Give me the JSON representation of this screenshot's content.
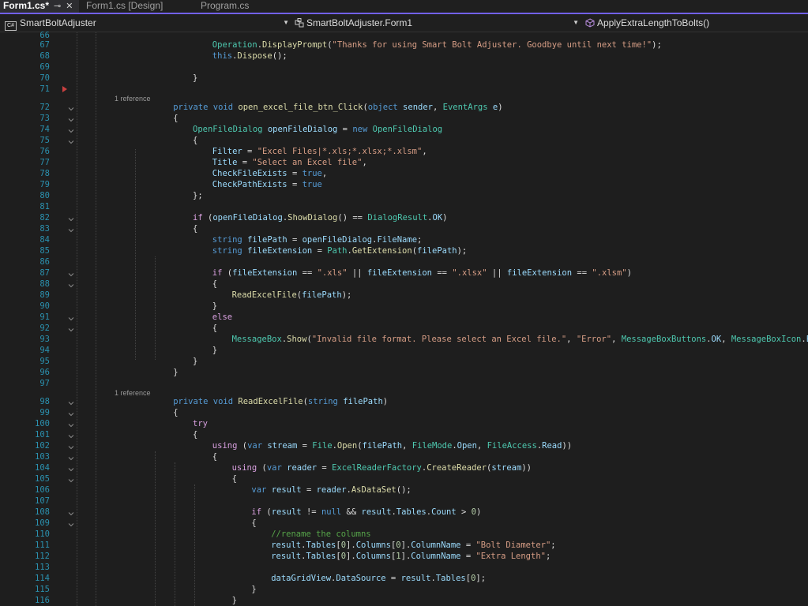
{
  "tabs": [
    {
      "label": "Form1.cs*",
      "active": true
    },
    {
      "label": "Form1.cs [Design]",
      "active": false
    },
    {
      "label": "Program.cs",
      "active": false
    }
  ],
  "tab_icons": {
    "pin": "⊸",
    "close": "✕"
  },
  "nav": {
    "project": "SmartBoltAdjuster",
    "cls": "SmartBoltAdjuster.Form1",
    "member": "ApplyExtraLengthToBolts()",
    "cs_icon_text": "C#"
  },
  "refs": {
    "r72": "1 reference",
    "r98": "1 reference"
  },
  "lines": [
    {
      "n": "66",
      "tokens": []
    },
    {
      "n": "67",
      "tokens": [
        [
          "t",
          "Operation"
        ],
        [
          "p",
          "."
        ],
        [
          "m",
          "DisplayPrompt"
        ],
        [
          "p",
          "("
        ],
        [
          "s",
          "\"Thanks for using Smart Bolt Adjuster. Goodbye until next time!\""
        ],
        [
          "p",
          ");"
        ]
      ]
    },
    {
      "n": "68",
      "tokens": [
        [
          "k",
          "this"
        ],
        [
          "p",
          "."
        ],
        [
          "m",
          "Dispose"
        ],
        [
          "p",
          "();"
        ]
      ]
    },
    {
      "n": "69",
      "tokens": []
    },
    {
      "n": "70",
      "tokens": [
        [
          "p",
          "}"
        ]
      ]
    },
    {
      "n": "71",
      "tokens": []
    },
    {
      "n": "72",
      "tokens": [
        [
          "k",
          "private"
        ],
        [
          "p",
          " "
        ],
        [
          "k",
          "void"
        ],
        [
          "p",
          " "
        ],
        [
          "m",
          "open_excel_file_btn_Click"
        ],
        [
          "p",
          "("
        ],
        [
          "k",
          "object"
        ],
        [
          "p",
          " "
        ],
        [
          "v",
          "sender"
        ],
        [
          "p",
          ", "
        ],
        [
          "t",
          "EventArgs"
        ],
        [
          "p",
          " "
        ],
        [
          "v",
          "e"
        ],
        [
          "p",
          ")"
        ]
      ]
    },
    {
      "n": "73",
      "tokens": [
        [
          "p",
          "{"
        ]
      ]
    },
    {
      "n": "74",
      "tokens": [
        [
          "t",
          "OpenFileDialog"
        ],
        [
          "p",
          " "
        ],
        [
          "v",
          "openFileDialog"
        ],
        [
          "p",
          " = "
        ],
        [
          "k",
          "new"
        ],
        [
          "p",
          " "
        ],
        [
          "t",
          "OpenFileDialog"
        ]
      ]
    },
    {
      "n": "75",
      "tokens": [
        [
          "p",
          "{"
        ]
      ]
    },
    {
      "n": "76",
      "tokens": [
        [
          "v",
          "Filter"
        ],
        [
          "p",
          " = "
        ],
        [
          "s",
          "\"Excel Files|*.xls;*.xlsx;*.xlsm\""
        ],
        [
          "p",
          ","
        ]
      ]
    },
    {
      "n": "77",
      "tokens": [
        [
          "v",
          "Title"
        ],
        [
          "p",
          " = "
        ],
        [
          "s",
          "\"Select an Excel file\""
        ],
        [
          "p",
          ","
        ]
      ]
    },
    {
      "n": "78",
      "tokens": [
        [
          "v",
          "CheckFileExists"
        ],
        [
          "p",
          " = "
        ],
        [
          "k",
          "true"
        ],
        [
          "p",
          ","
        ]
      ]
    },
    {
      "n": "79",
      "tokens": [
        [
          "v",
          "CheckPathExists"
        ],
        [
          "p",
          " = "
        ],
        [
          "k",
          "true"
        ]
      ]
    },
    {
      "n": "80",
      "tokens": [
        [
          "p",
          "};"
        ]
      ]
    },
    {
      "n": "81",
      "tokens": []
    },
    {
      "n": "82",
      "tokens": [
        [
          "cf",
          "if"
        ],
        [
          "p",
          " ("
        ],
        [
          "v",
          "openFileDialog"
        ],
        [
          "p",
          "."
        ],
        [
          "m",
          "ShowDialog"
        ],
        [
          "p",
          "() == "
        ],
        [
          "t",
          "DialogResult"
        ],
        [
          "p",
          "."
        ],
        [
          "v",
          "OK"
        ],
        [
          "p",
          ")"
        ]
      ]
    },
    {
      "n": "83",
      "tokens": [
        [
          "p",
          "{"
        ]
      ]
    },
    {
      "n": "84",
      "tokens": [
        [
          "k",
          "string"
        ],
        [
          "p",
          " "
        ],
        [
          "v",
          "filePath"
        ],
        [
          "p",
          " = "
        ],
        [
          "v",
          "openFileDialog"
        ],
        [
          "p",
          "."
        ],
        [
          "v",
          "FileName"
        ],
        [
          "p",
          ";"
        ]
      ]
    },
    {
      "n": "85",
      "tokens": [
        [
          "k",
          "string"
        ],
        [
          "p",
          " "
        ],
        [
          "v",
          "fileExtension"
        ],
        [
          "p",
          " = "
        ],
        [
          "t",
          "Path"
        ],
        [
          "p",
          "."
        ],
        [
          "m",
          "GetExtension"
        ],
        [
          "p",
          "("
        ],
        [
          "v",
          "filePath"
        ],
        [
          "p",
          ");"
        ]
      ]
    },
    {
      "n": "86",
      "tokens": []
    },
    {
      "n": "87",
      "tokens": [
        [
          "cf",
          "if"
        ],
        [
          "p",
          " ("
        ],
        [
          "v",
          "fileExtension"
        ],
        [
          "p",
          " == "
        ],
        [
          "s",
          "\".xls\""
        ],
        [
          "p",
          " || "
        ],
        [
          "v",
          "fileExtension"
        ],
        [
          "p",
          " == "
        ],
        [
          "s",
          "\".xlsx\""
        ],
        [
          "p",
          " || "
        ],
        [
          "v",
          "fileExtension"
        ],
        [
          "p",
          " == "
        ],
        [
          "s",
          "\".xlsm\""
        ],
        [
          "p",
          ")"
        ]
      ]
    },
    {
      "n": "88",
      "tokens": [
        [
          "p",
          "{"
        ]
      ]
    },
    {
      "n": "89",
      "tokens": [
        [
          "m",
          "ReadExcelFile"
        ],
        [
          "p",
          "("
        ],
        [
          "v",
          "filePath"
        ],
        [
          "p",
          ");"
        ]
      ]
    },
    {
      "n": "90",
      "tokens": [
        [
          "p",
          "}"
        ]
      ]
    },
    {
      "n": "91",
      "tokens": [
        [
          "cf",
          "else"
        ]
      ]
    },
    {
      "n": "92",
      "tokens": [
        [
          "p",
          "{"
        ]
      ]
    },
    {
      "n": "93",
      "tokens": [
        [
          "t",
          "MessageBox"
        ],
        [
          "p",
          "."
        ],
        [
          "m",
          "Show"
        ],
        [
          "p",
          "("
        ],
        [
          "s",
          "\"Invalid file format. Please select an Excel file.\""
        ],
        [
          "p",
          ", "
        ],
        [
          "s",
          "\"Error\""
        ],
        [
          "p",
          ", "
        ],
        [
          "t",
          "MessageBoxButtons"
        ],
        [
          "p",
          "."
        ],
        [
          "v",
          "OK"
        ],
        [
          "p",
          ", "
        ],
        [
          "t",
          "MessageBoxIcon"
        ],
        [
          "p",
          "."
        ],
        [
          "v",
          "Error"
        ],
        [
          "p",
          ");"
        ]
      ]
    },
    {
      "n": "94",
      "tokens": [
        [
          "p",
          "}"
        ]
      ]
    },
    {
      "n": "95",
      "tokens": [
        [
          "p",
          "}"
        ]
      ]
    },
    {
      "n": "96",
      "tokens": [
        [
          "p",
          "}"
        ]
      ]
    },
    {
      "n": "97",
      "tokens": []
    },
    {
      "n": "98",
      "tokens": [
        [
          "k",
          "private"
        ],
        [
          "p",
          " "
        ],
        [
          "k",
          "void"
        ],
        [
          "p",
          " "
        ],
        [
          "m",
          "ReadExcelFile"
        ],
        [
          "p",
          "("
        ],
        [
          "k",
          "string"
        ],
        [
          "p",
          " "
        ],
        [
          "v",
          "filePath"
        ],
        [
          "p",
          ")"
        ]
      ]
    },
    {
      "n": "99",
      "tokens": [
        [
          "p",
          "{"
        ]
      ]
    },
    {
      "n": "100",
      "tokens": [
        [
          "cf",
          "try"
        ]
      ]
    },
    {
      "n": "101",
      "tokens": [
        [
          "p",
          "{"
        ]
      ]
    },
    {
      "n": "102",
      "tokens": [
        [
          "cf",
          "using"
        ],
        [
          "p",
          " ("
        ],
        [
          "k",
          "var"
        ],
        [
          "p",
          " "
        ],
        [
          "v",
          "stream"
        ],
        [
          "p",
          " = "
        ],
        [
          "t",
          "File"
        ],
        [
          "p",
          "."
        ],
        [
          "m",
          "Open"
        ],
        [
          "p",
          "("
        ],
        [
          "v",
          "filePath"
        ],
        [
          "p",
          ", "
        ],
        [
          "t",
          "FileMode"
        ],
        [
          "p",
          "."
        ],
        [
          "v",
          "Open"
        ],
        [
          "p",
          ", "
        ],
        [
          "t",
          "FileAccess"
        ],
        [
          "p",
          "."
        ],
        [
          "v",
          "Read"
        ],
        [
          "p",
          "))"
        ]
      ]
    },
    {
      "n": "103",
      "tokens": [
        [
          "p",
          "{"
        ]
      ]
    },
    {
      "n": "104",
      "tokens": [
        [
          "cf",
          "using"
        ],
        [
          "p",
          " ("
        ],
        [
          "k",
          "var"
        ],
        [
          "p",
          " "
        ],
        [
          "v",
          "reader"
        ],
        [
          "p",
          " = "
        ],
        [
          "t",
          "ExcelReaderFactory"
        ],
        [
          "p",
          "."
        ],
        [
          "m",
          "CreateReader"
        ],
        [
          "p",
          "("
        ],
        [
          "v",
          "stream"
        ],
        [
          "p",
          "))"
        ]
      ]
    },
    {
      "n": "105",
      "tokens": [
        [
          "p",
          "{"
        ]
      ]
    },
    {
      "n": "106",
      "tokens": [
        [
          "k",
          "var"
        ],
        [
          "p",
          " "
        ],
        [
          "v",
          "result"
        ],
        [
          "p",
          " = "
        ],
        [
          "v",
          "reader"
        ],
        [
          "p",
          "."
        ],
        [
          "m",
          "AsDataSet"
        ],
        [
          "p",
          "();"
        ]
      ]
    },
    {
      "n": "107",
      "tokens": []
    },
    {
      "n": "108",
      "tokens": [
        [
          "cf",
          "if"
        ],
        [
          "p",
          " ("
        ],
        [
          "v",
          "result"
        ],
        [
          "p",
          " != "
        ],
        [
          "k",
          "null"
        ],
        [
          "p",
          " && "
        ],
        [
          "v",
          "result"
        ],
        [
          "p",
          "."
        ],
        [
          "v",
          "Tables"
        ],
        [
          "p",
          "."
        ],
        [
          "v",
          "Count"
        ],
        [
          "p",
          " > "
        ],
        [
          "n",
          "0"
        ],
        [
          "p",
          ")"
        ]
      ]
    },
    {
      "n": "109",
      "tokens": [
        [
          "p",
          "{"
        ]
      ]
    },
    {
      "n": "110",
      "tokens": [
        [
          "c",
          "//rename the columns"
        ]
      ]
    },
    {
      "n": "111",
      "tokens": [
        [
          "v",
          "result"
        ],
        [
          "p",
          "."
        ],
        [
          "v",
          "Tables"
        ],
        [
          "p",
          "["
        ],
        [
          "n",
          "0"
        ],
        [
          "p",
          "]."
        ],
        [
          "v",
          "Columns"
        ],
        [
          "p",
          "["
        ],
        [
          "n",
          "0"
        ],
        [
          "p",
          "]."
        ],
        [
          "v",
          "ColumnName"
        ],
        [
          "p",
          " = "
        ],
        [
          "s",
          "\"Bolt Diameter\""
        ],
        [
          "p",
          ";"
        ]
      ]
    },
    {
      "n": "112",
      "tokens": [
        [
          "v",
          "result"
        ],
        [
          "p",
          "."
        ],
        [
          "v",
          "Tables"
        ],
        [
          "p",
          "["
        ],
        [
          "n",
          "0"
        ],
        [
          "p",
          "]."
        ],
        [
          "v",
          "Columns"
        ],
        [
          "p",
          "["
        ],
        [
          "n",
          "1"
        ],
        [
          "p",
          "]."
        ],
        [
          "v",
          "ColumnName"
        ],
        [
          "p",
          " = "
        ],
        [
          "s",
          "\"Extra Length\""
        ],
        [
          "p",
          ";"
        ]
      ]
    },
    {
      "n": "113",
      "tokens": []
    },
    {
      "n": "114",
      "tokens": [
        [
          "v",
          "dataGridView"
        ],
        [
          "p",
          "."
        ],
        [
          "v",
          "DataSource"
        ],
        [
          "p",
          " = "
        ],
        [
          "v",
          "result"
        ],
        [
          "p",
          "."
        ],
        [
          "v",
          "Tables"
        ],
        [
          "p",
          "["
        ],
        [
          "n",
          "0"
        ],
        [
          "p",
          "];"
        ]
      ]
    },
    {
      "n": "115",
      "tokens": [
        [
          "p",
          "}"
        ]
      ]
    },
    {
      "n": "116",
      "tokens": [
        [
          "p",
          "}"
        ]
      ]
    }
  ]
}
